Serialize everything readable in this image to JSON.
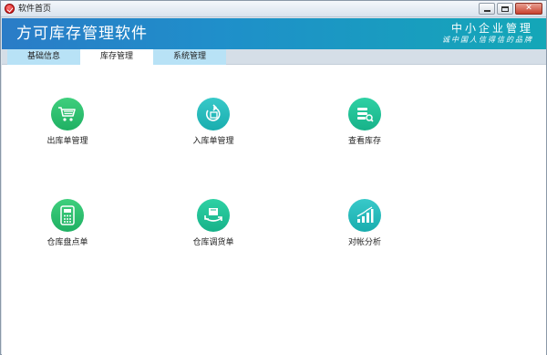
{
  "window": {
    "title": "软件首页"
  },
  "header": {
    "title": "方可库存管理软件",
    "brand_main": "中小企业管理",
    "brand_sub": "诚中国人信得信的品牌"
  },
  "tabs": [
    {
      "label": "基础信息",
      "active": false
    },
    {
      "label": "库存管理",
      "active": true
    },
    {
      "label": "系统管理",
      "active": false
    }
  ],
  "tiles": [
    {
      "label": "出库单管理",
      "icon": "shopping-cart-icon",
      "color": "#2bbf6f"
    },
    {
      "label": "入库单管理",
      "icon": "return-box-icon",
      "color": "#1fb3b3"
    },
    {
      "label": "查看库存",
      "icon": "stack-search-icon",
      "color": "#1fbb8c"
    },
    {
      "label": "仓库盘点单",
      "icon": "calculator-icon",
      "color": "#2bbf6f"
    },
    {
      "label": "仓库调货单",
      "icon": "transfer-icon",
      "color": "#1fbf9c"
    },
    {
      "label": "对帐分析",
      "icon": "bar-chart-icon",
      "color": "#1fb3a3"
    }
  ],
  "colors": {
    "banner_start": "#2a7cc7",
    "banner_end": "#14a7b7",
    "tab_inactive": "#b8e2f6",
    "tab_active": "#ffffff"
  }
}
